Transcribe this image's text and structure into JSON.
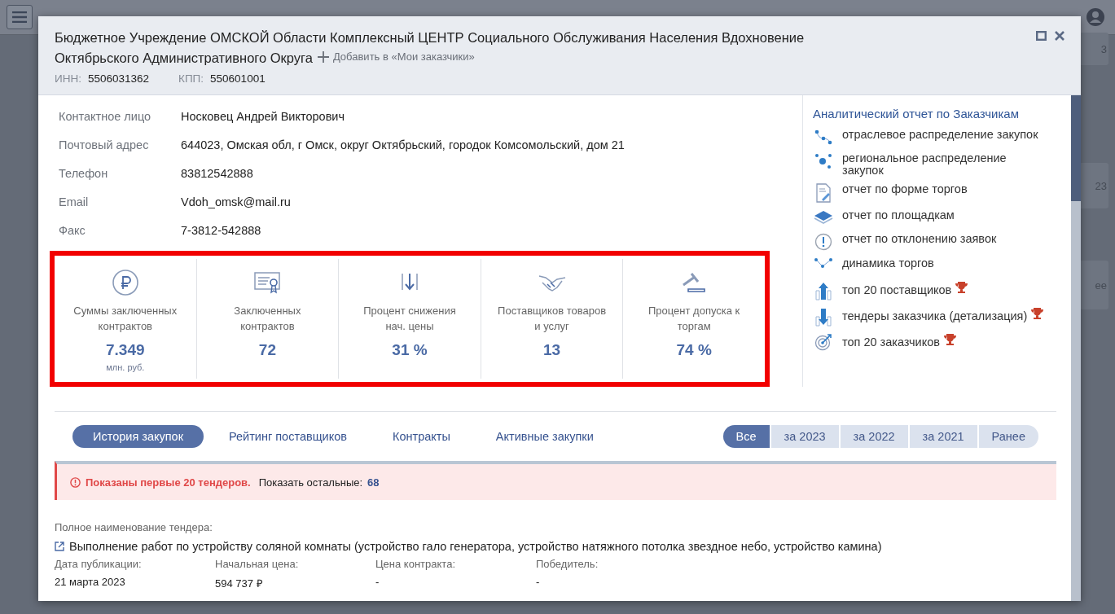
{
  "background": {
    "side_texts": [
      "3",
      "23",
      "ее"
    ]
  },
  "dialog": {
    "title_lines": [
      "Бюджетное Учреждение ОМСКОЙ Области Комплексный ЦЕНТР Социального Обслуживания Населения Вдохновение",
      "Октябрьского Административного Округа"
    ],
    "add_link": "Добавить в «Мои заказчики»",
    "inn_label": "ИНН:",
    "inn": "5506031362",
    "kpp_label": "КПП:",
    "kpp": "550601001"
  },
  "contacts": [
    {
      "label": "Контактное лицо",
      "value": "Носковец Андрей Викторович"
    },
    {
      "label": "Почтовый адрес",
      "value": "644023, Омская обл, г Омск, округ Октябрьский, городок Комсомольский, дом 21"
    },
    {
      "label": "Телефон",
      "value": "83812542888"
    },
    {
      "label": "Email",
      "value": "Vdoh_omsk@mail.ru"
    },
    {
      "label": "Факс",
      "value": "7-3812-542888"
    }
  ],
  "stats": [
    {
      "kind": "ruble",
      "label": "Суммы заключенных контрактов",
      "value": "7.349",
      "unit": "млн. руб."
    },
    {
      "kind": "certificate",
      "label": "Заключенных контрактов",
      "value": "72"
    },
    {
      "kind": "decline",
      "label": "Процент снижения нач. цены",
      "value": "31 %"
    },
    {
      "kind": "handshake",
      "label": "Поставщиков товаров и услуг",
      "value": "13"
    },
    {
      "kind": "gavel",
      "label": "Процент допуска к торгам",
      "value": "74 %"
    }
  ],
  "reports": {
    "title": "Аналитический отчет по Заказчикам",
    "items": [
      {
        "kind": "dots-line",
        "label": "отраслевое распределение закупок",
        "premium": false
      },
      {
        "kind": "dots-hub",
        "label": "региональное распределение закупок",
        "premium": false
      },
      {
        "kind": "document",
        "label": "отчет по форме торгов",
        "premium": false
      },
      {
        "kind": "layers",
        "label": "отчет по площадкам",
        "premium": false
      },
      {
        "kind": "alert",
        "label": "отчет по отклонению заявок",
        "premium": false
      },
      {
        "kind": "dots-wave",
        "label": "динамика торгов",
        "premium": false
      },
      {
        "kind": "arrow-up",
        "label": "топ 20 поставщиков",
        "premium": true
      },
      {
        "kind": "arrow-down",
        "label": "тендеры заказчика (детализация)",
        "premium": true
      },
      {
        "kind": "target",
        "label": "топ 20 заказчиков",
        "premium": true
      }
    ]
  },
  "tabs": [
    {
      "label": "История закупок",
      "selected": true
    },
    {
      "label": "Рейтинг поставщиков",
      "selected": false
    },
    {
      "label": "Контракты",
      "selected": false
    },
    {
      "label": "Активные закупки",
      "selected": false
    }
  ],
  "periods": [
    {
      "label": "Все",
      "selected": true
    },
    {
      "label": "за 2023",
      "selected": false
    },
    {
      "label": "за 2022",
      "selected": false
    },
    {
      "label": "за 2021",
      "selected": false
    },
    {
      "label": "Ранее",
      "selected": false
    }
  ],
  "notice": {
    "text": "Показаны первые 20 тендеров.",
    "more_label": "Показать остальные:",
    "more_count": "68"
  },
  "tender": {
    "name_label": "Полное наименование тендера:",
    "name": "Выполнение работ по устройству соляной комнаты (устройство гало генератора, устройство натяжного потолка звездное небо, устройство камина)",
    "fields": [
      {
        "label": "Дата публикации:",
        "value": "21 марта 2023"
      },
      {
        "label": "Начальная цена:",
        "value": "594 737 ₽"
      },
      {
        "label": "Цена контракта:",
        "value": "-"
      },
      {
        "label": "Победитель:",
        "value": "-"
      }
    ]
  }
}
